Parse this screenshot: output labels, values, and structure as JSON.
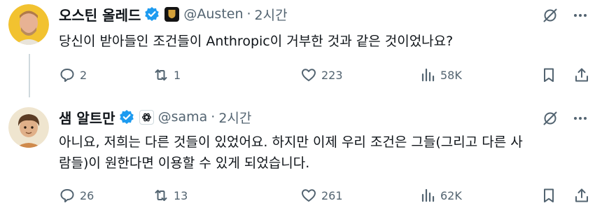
{
  "tweets": [
    {
      "display_name": "오스틴 올레드",
      "handle": "@Austen",
      "separator": "·",
      "time": "2시간",
      "text_lines": [
        "당신이 받아들인 조건들이 Anthropic이 거부한 것과 같은 것이었나요?"
      ],
      "replies": "2",
      "retweets": "1",
      "likes": "223",
      "views": "58K"
    },
    {
      "display_name": "샘 알트만",
      "handle": "@sama",
      "separator": "·",
      "time": "2시간",
      "text_lines": [
        "아니요, 저희는 다른 것들이 있었어요. 하지만 이제 우리 조건은 그들(그리고 다른 사",
        "람들)이 원한다면 이용할 수 있게 되었습니다."
      ],
      "replies": "26",
      "retweets": "13",
      "likes": "261",
      "views": "62K"
    }
  ],
  "colors": {
    "verified_blue": "#1d9bf0",
    "text_primary": "#0f1419",
    "text_secondary": "#536471",
    "thread_line": "#cfd9de"
  },
  "icons": {
    "verified": "verified-badge-icon",
    "grok": "grok-icon",
    "more": "more-icon",
    "reply": "reply-icon",
    "retweet": "retweet-icon",
    "like": "heart-icon",
    "views": "views-icon",
    "bookmark": "bookmark-icon",
    "share": "share-icon"
  }
}
